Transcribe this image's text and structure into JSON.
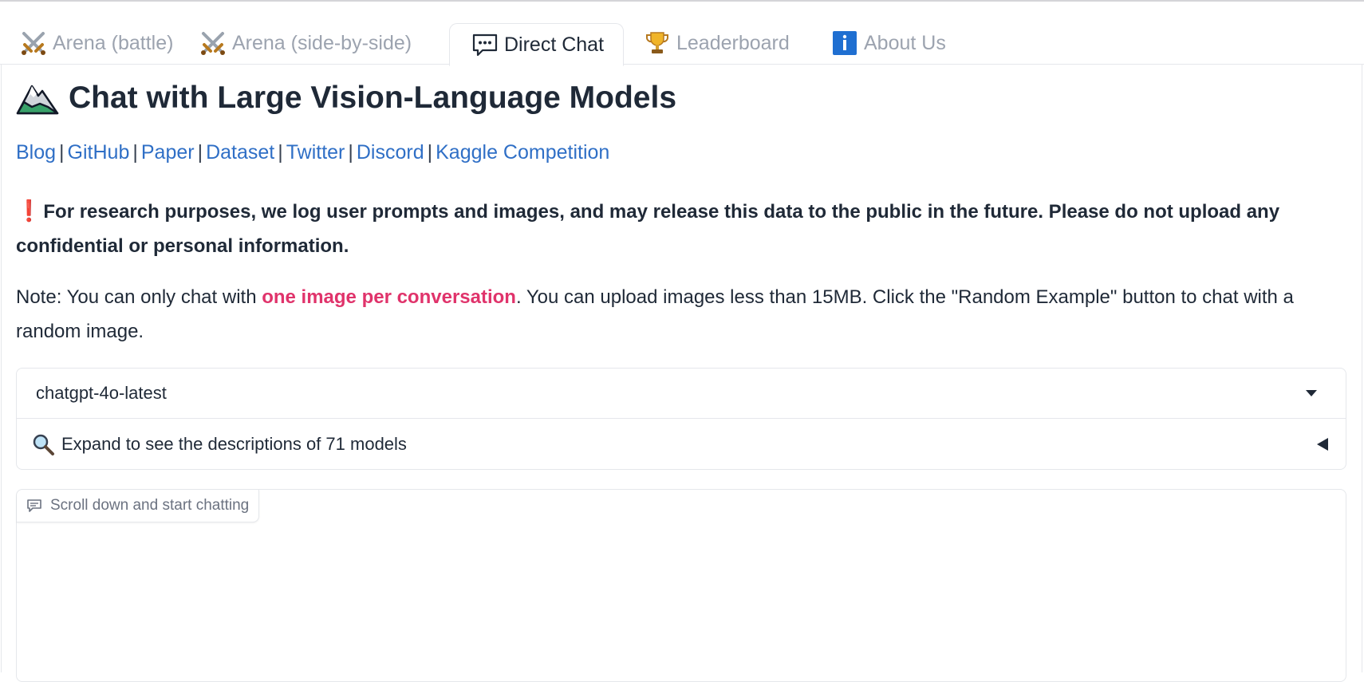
{
  "tabs": [
    {
      "label": "Arena (battle)",
      "icon": "crossed-swords-icon",
      "active": false
    },
    {
      "label": "Arena (side-by-side)",
      "icon": "crossed-swords-icon",
      "active": false
    },
    {
      "label": "Direct Chat",
      "icon": "speech-bubble-icon",
      "active": true
    },
    {
      "label": "Leaderboard",
      "icon": "trophy-icon",
      "active": false
    },
    {
      "label": "About Us",
      "icon": "info-icon",
      "active": false
    }
  ],
  "header": {
    "title": "Chat with Large Vision-Language Models",
    "title_icon": "mountain-icon"
  },
  "links": [
    {
      "label": "Blog"
    },
    {
      "label": "GitHub"
    },
    {
      "label": "Paper"
    },
    {
      "label": "Dataset"
    },
    {
      "label": "Twitter"
    },
    {
      "label": "Discord"
    },
    {
      "label": "Kaggle Competition"
    }
  ],
  "warning": {
    "text": "For research purposes, we log user prompts and images, and may release this data to the public in the future. Please do not upload any confidential or personal information."
  },
  "note": {
    "prefix": "Note: You can only chat with ",
    "highlight": "one image per conversation",
    "suffix": ". You can upload images less than 15MB. Click the \"Random Example\" button to chat with a random image."
  },
  "model_selector": {
    "selected": "chatgpt-4o-latest",
    "accordion_label": "Expand to see the descriptions of 71 models"
  },
  "chat": {
    "label": "Scroll down and start chatting"
  },
  "colors": {
    "link": "#2f6fc6",
    "highlight": "#e0336b",
    "warning_mark": "#e11d48",
    "border": "#e5e7eb"
  }
}
